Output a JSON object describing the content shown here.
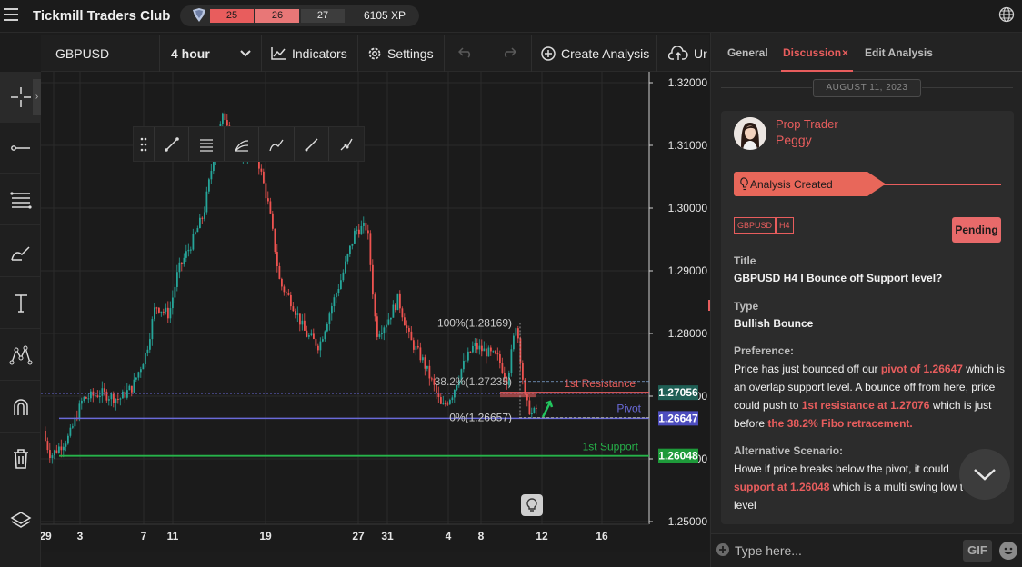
{
  "app": {
    "title": "Tickmill Traders Club"
  },
  "xp": {
    "seg1": "25",
    "seg2": "26",
    "seg3": "27",
    "total": "6105 XP"
  },
  "toolbar": {
    "symbol": "GBPUSD",
    "interval": "4 hour",
    "indicators": "Indicators",
    "settings": "Settings",
    "create_analysis": "Create Analysis",
    "upload_partial": "Ur"
  },
  "chart": {
    "price_ticks": [
      "1.32000",
      "1.31000",
      "1.30000",
      "1.29000",
      "1.28000",
      "1.27000",
      "1.26000",
      "1.25000"
    ],
    "date_ticks": [
      "29",
      "3",
      "7",
      "11",
      "19",
      "27",
      "31",
      "4",
      "8",
      "12",
      "16"
    ],
    "levels": {
      "resistance": {
        "label": "1st Resistance",
        "price": "1.27056",
        "color": "#e85d5d"
      },
      "pivot": {
        "label": "Pivot",
        "price": "1.26647",
        "color": "#6a6ad8"
      },
      "support": {
        "label": "1st Support",
        "price": "1.26048",
        "color": "#26b34a"
      }
    },
    "fib": {
      "f100": "100%(1.28169)",
      "f382": "38.2%(1.27235)",
      "f0": "0%(1.26657)"
    },
    "colors": {
      "up": "#26a69a",
      "down": "#ef5350",
      "bg": "#1b1b1b"
    }
  },
  "panel": {
    "tabs": [
      "General",
      "Discussion",
      "Edit Analysis"
    ],
    "active_tab": "Discussion",
    "date": "AUGUST 11, 2023",
    "role": "Prop Trader",
    "user": "Peggy",
    "status": "Analysis Created",
    "tags": [
      "GBPUSD",
      "H4"
    ],
    "pending": "Pending",
    "title_label": "Title",
    "title_value": "GBPUSD H4 I Bounce off Support level?",
    "type_label": "Type",
    "type_value": "Bullish Bounce",
    "pref_label": "Preference:",
    "pref_a": "Price has just bounced off our ",
    "pref_b": "pivot of 1.26647",
    "pref_c": " which is an overlap support level. A bounce off from here, price could push to ",
    "pref_d": "1st resistance at 1.27076",
    "pref_e": " which  is just before ",
    "pref_f": "the 38.2% Fibo retracement.",
    "alt_label": "Alternative Scenario:",
    "alt_a": "Howe if price breaks below the pivot, it could",
    "alt_b": "support at 1.26048",
    "alt_c": " which is a multi swing low",
    "alt_d": "t",
    "alt_e": "level",
    "composer_placeholder": "Type here...",
    "gif": "GIF"
  }
}
